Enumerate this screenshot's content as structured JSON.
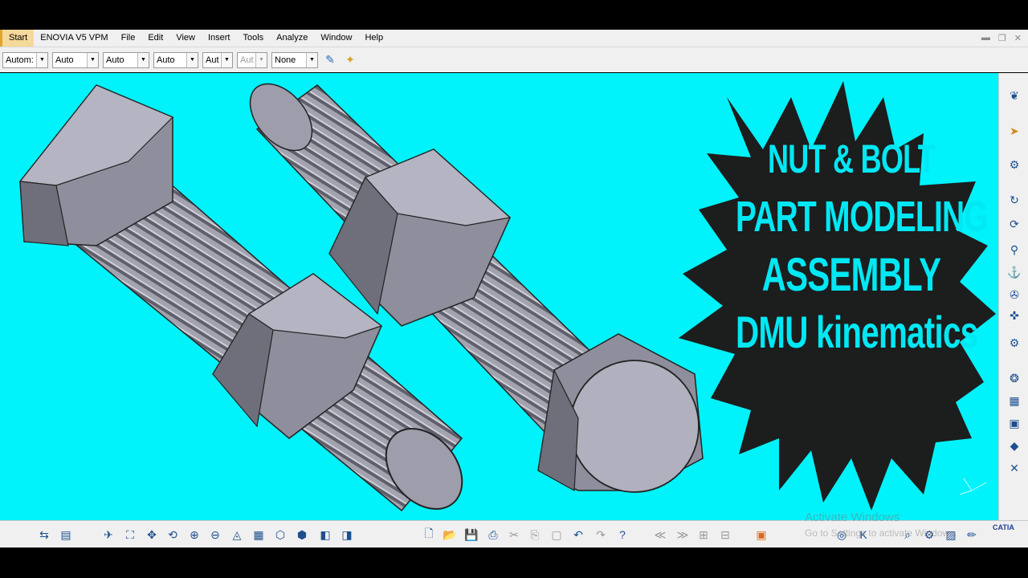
{
  "menubar": {
    "items": [
      "Start",
      "ENOVIA V5 VPM",
      "File",
      "Edit",
      "View",
      "Insert",
      "Tools",
      "Analyze",
      "Window",
      "Help"
    ]
  },
  "toolbar": {
    "combos": [
      {
        "value": "Autom:",
        "disabled": false
      },
      {
        "value": "Auto",
        "disabled": false
      },
      {
        "value": "Auto",
        "disabled": false
      },
      {
        "value": "Auto",
        "disabled": false
      },
      {
        "value": "Aut",
        "disabled": false
      },
      {
        "value": "Aut",
        "disabled": true
      },
      {
        "value": "None",
        "disabled": false
      }
    ]
  },
  "overlay": {
    "line1": "NUT & BOLT",
    "line2": "PART MODELING",
    "line3": "ASSEMBLY",
    "line4": "DMU kinematics"
  },
  "watermark": {
    "line1": "Activate Windows",
    "line2": "Go to Settings to activate Windows."
  },
  "logo": "CATIA",
  "colors": {
    "viewport_bg": "#00f2fa",
    "overlay_text": "#00e8f4",
    "starburst": "#1c1d1d",
    "part_face": "#9a9aa8"
  }
}
